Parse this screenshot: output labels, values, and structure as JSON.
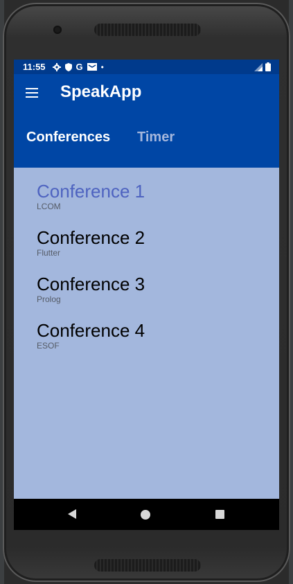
{
  "status_bar": {
    "time": "11:55",
    "icons": [
      "gear-icon",
      "shield-icon",
      "google-icon",
      "mail-icon",
      "dot-icon"
    ],
    "google_glyph": "G",
    "dot_glyph": "•"
  },
  "app_bar": {
    "title": "SpeakApp"
  },
  "tabs": [
    {
      "label": "Conferences",
      "selected": true
    },
    {
      "label": "Timer",
      "selected": false
    }
  ],
  "conferences": [
    {
      "title": "Conference 1",
      "subtitle": "LCOM"
    },
    {
      "title": "Conference 2",
      "subtitle": "Flutter"
    },
    {
      "title": "Conference 3",
      "subtitle": "Prolog"
    },
    {
      "title": "Conference 4",
      "subtitle": "ESOF"
    }
  ],
  "colors": {
    "status_bar": "#003a8c",
    "app_bar": "#0046a5",
    "list_background": "#a3b7dd",
    "active_item": "#4e63c0",
    "inactive_tab": "#a5b7dd"
  }
}
